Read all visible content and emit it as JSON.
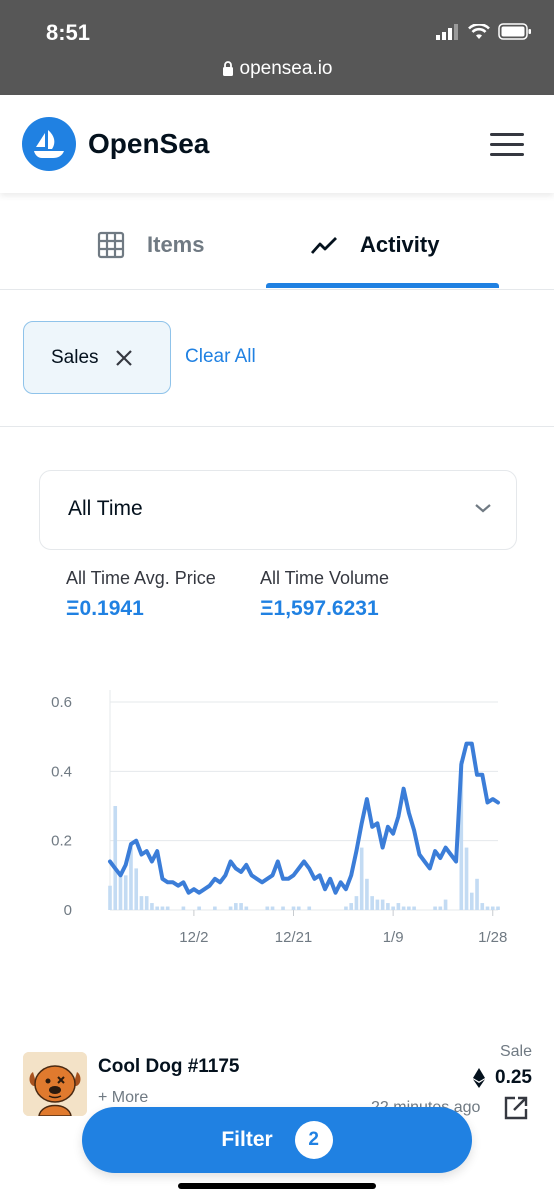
{
  "status_bar": {
    "time": "8:51",
    "url": "opensea.io"
  },
  "header": {
    "brand": "OpenSea"
  },
  "tabs": [
    {
      "label": "Items",
      "icon": "grid-icon",
      "active": false
    },
    {
      "label": "Activity",
      "icon": "activity-chart-icon",
      "active": true
    }
  ],
  "filters": {
    "chip_label": "Sales",
    "clear_all": "Clear All"
  },
  "dropdown": {
    "selected": "All Time"
  },
  "stats": {
    "avg_price_label": "All Time Avg. Price",
    "avg_price_value": "Ξ0.1941",
    "volume_label": "All Time Volume",
    "volume_value": "Ξ1,597.6231"
  },
  "chart_data": {
    "type": "line",
    "ylim": [
      0,
      0.6
    ],
    "y_ticks": [
      "0",
      "0.2",
      "0.4",
      "0.6"
    ],
    "x_tick_labels": [
      "12/2",
      "12/21",
      "1/9",
      "1/28"
    ],
    "x_tick_index": [
      16,
      35,
      54,
      73
    ],
    "grid": true,
    "line_color": "#3b7dd8",
    "bar_color": "#c3dbf3",
    "series": [
      {
        "values": [
          0.14,
          0.12,
          0.1,
          0.13,
          0.19,
          0.2,
          0.16,
          0.17,
          0.14,
          0.17,
          0.09,
          0.08,
          0.08,
          0.07,
          0.08,
          0.05,
          0.06,
          0.05,
          0.06,
          0.07,
          0.09,
          0.08,
          0.1,
          0.14,
          0.12,
          0.11,
          0.13,
          0.1,
          0.09,
          0.08,
          0.09,
          0.1,
          0.14,
          0.09,
          0.09,
          0.1,
          0.12,
          0.14,
          0.12,
          0.09,
          0.1,
          0.06,
          0.09,
          0.05,
          0.08,
          0.06,
          0.1,
          0.17,
          0.25,
          0.32,
          0.24,
          0.25,
          0.18,
          0.24,
          0.22,
          0.27,
          0.35,
          0.28,
          0.23,
          0.16,
          0.14,
          0.12,
          0.17,
          0.15,
          0.18,
          0.16,
          0.14,
          0.42,
          0.48,
          0.48,
          0.39,
          0.39,
          0.31,
          0.32,
          0.31
        ]
      },
      {
        "values": [
          0.07,
          0.3,
          0.11,
          0.1,
          0.18,
          0.12,
          0.04,
          0.04,
          0.02,
          0.01,
          0.01,
          0.01,
          0.0,
          0.0,
          0.01,
          0.0,
          0.0,
          0.01,
          0.0,
          0.0,
          0.01,
          0.0,
          0.0,
          0.01,
          0.02,
          0.02,
          0.01,
          0.0,
          0.0,
          0.0,
          0.01,
          0.01,
          0.0,
          0.01,
          0.0,
          0.01,
          0.01,
          0.0,
          0.01,
          0.0,
          0.0,
          0.0,
          0.0,
          0.0,
          0.0,
          0.01,
          0.02,
          0.04,
          0.18,
          0.09,
          0.04,
          0.03,
          0.03,
          0.02,
          0.01,
          0.02,
          0.01,
          0.01,
          0.01,
          0.0,
          0.0,
          0.0,
          0.01,
          0.01,
          0.03,
          0.0,
          0.0,
          0.43,
          0.18,
          0.05,
          0.09,
          0.02,
          0.01,
          0.01,
          0.01
        ]
      }
    ]
  },
  "list_item": {
    "name": "Cool Dog #1175",
    "more": "+ More",
    "event": "Sale",
    "price": "0.25",
    "time_ago": "22 minutes ago"
  },
  "filter_button": {
    "label": "Filter",
    "count": "2"
  },
  "colors": {
    "accent": "#2081e2",
    "status_bar": "#575757",
    "text": "#04111d"
  }
}
